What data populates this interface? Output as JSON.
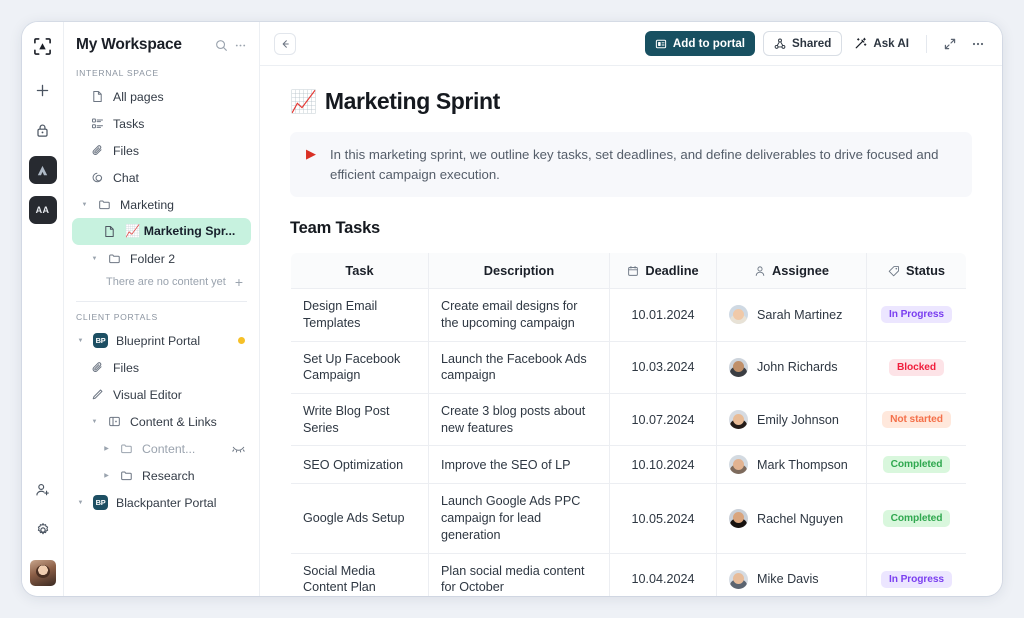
{
  "rail": {
    "items": [
      {
        "name": "app-logo",
        "label": ""
      },
      {
        "name": "add",
        "label": "+"
      },
      {
        "name": "lock",
        "label": ""
      },
      {
        "name": "brand-a",
        "label": ""
      },
      {
        "name": "brand-aa",
        "label": "AA"
      }
    ],
    "bottom": [
      {
        "name": "invite-user",
        "label": ""
      },
      {
        "name": "settings",
        "label": ""
      },
      {
        "name": "profile-avatar",
        "label": ""
      }
    ]
  },
  "sidebar": {
    "workspace_title": "My Workspace",
    "internal_label": "INTERNAL SPACE",
    "internal_items": [
      {
        "label": "All pages",
        "icon": "page-icon",
        "indent": 1
      },
      {
        "label": "Tasks",
        "icon": "tasks-icon",
        "indent": 1
      },
      {
        "label": "Files",
        "icon": "paperclip-icon",
        "indent": 1
      },
      {
        "label": "Chat",
        "icon": "chat-icon",
        "indent": 1
      }
    ],
    "marketing_folder": "Marketing",
    "selected_page": "📈 Marketing Spr...",
    "folder2": "Folder 2",
    "empty_text": "There are no content yet",
    "client_label": "CLIENT PORTALS",
    "portal_badge": "BP",
    "blueprint_portal": "Blueprint Portal",
    "portal_items": [
      {
        "label": "Files",
        "icon": "paperclip-icon"
      },
      {
        "label": "Visual Editor",
        "icon": "pencil-icon"
      }
    ],
    "content_links": "Content & Links",
    "content_folder": "Content...",
    "research_folder": "Research",
    "blackpanter_portal": "Blackpanter Portal"
  },
  "toolbar": {
    "back_label": "",
    "add_to_portal": "Add to portal",
    "shared": "Shared",
    "ask_ai": "Ask AI",
    "expand_label": "",
    "more_label": "",
    "primary_color": "#185061"
  },
  "document": {
    "title_emoji": "📈",
    "title": "Marketing Sprint",
    "callout_icon": "▶",
    "callout": "In this marketing sprint, we outline key tasks, set deadlines, and define deliverables to drive focused and efficient campaign execution.",
    "section_heading": "Team Tasks"
  },
  "table": {
    "columns": [
      {
        "label": "Task",
        "icon": null
      },
      {
        "label": "Description",
        "icon": null
      },
      {
        "label": "Deadline",
        "icon": "calendar-icon"
      },
      {
        "label": "Assignee",
        "icon": "person-icon"
      },
      {
        "label": "Status",
        "icon": "tag-icon"
      }
    ],
    "rows": [
      {
        "task": "Design Email Templates",
        "description": "Create email designs for the upcoming campaign",
        "deadline": "10.01.2024",
        "assignee": "Sarah Martinez",
        "status": "In Progress",
        "status_key": "inprogress"
      },
      {
        "task": "Set Up Facebook Campaign",
        "description": "Launch the Facebook Ads campaign",
        "deadline": "10.03.2024",
        "assignee": "John Richards",
        "status": "Blocked",
        "status_key": "blocked"
      },
      {
        "task": "Write Blog Post Series",
        "description": "Create 3 blog posts about new features",
        "deadline": "10.07.2024",
        "assignee": "Emily Johnson",
        "status": "Not started",
        "status_key": "notstarted"
      },
      {
        "task": "SEO Optimization",
        "description": "Improve the SEO of LP",
        "deadline": "10.10.2024",
        "assignee": "Mark Thompson",
        "status": "Completed",
        "status_key": "completed"
      },
      {
        "task": "Google Ads Setup",
        "description": "Launch Google Ads PPC campaign for lead generation",
        "deadline": "10.05.2024",
        "assignee": "Rachel Nguyen",
        "status": "Completed",
        "status_key": "completed"
      },
      {
        "task": "Social Media Content Plan",
        "description": "Plan social media content for October",
        "deadline": "10.04.2024",
        "assignee": "Mike Davis",
        "status": "In Progress",
        "status_key": "inprogress"
      }
    ]
  },
  "colors": {
    "accent": "#185061",
    "selection": "#c7f2df",
    "status_dot": "#f6c028"
  }
}
